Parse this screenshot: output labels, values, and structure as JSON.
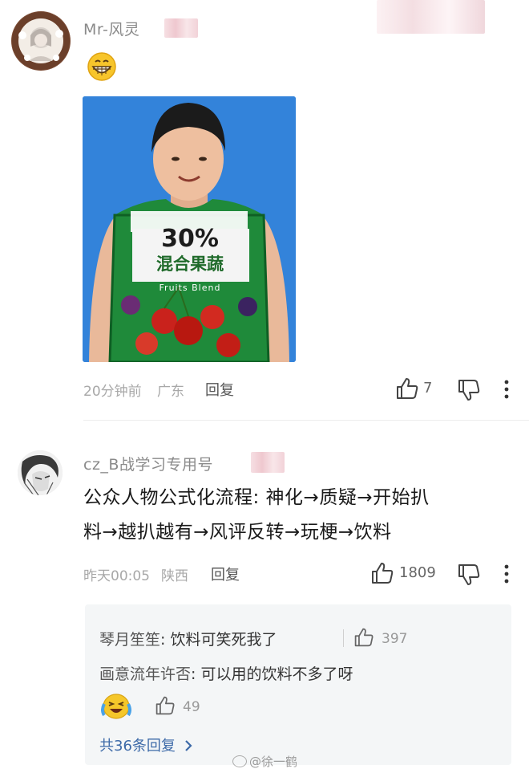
{
  "comments": [
    {
      "username": "Mr-风灵",
      "emoji": "grinning-face",
      "time": "20分钟前",
      "location": "广东",
      "reply_label": "回复",
      "likes": "7",
      "shirt": {
        "line1": "30%",
        "line2": "混合果蔬",
        "line3": "Fruits Blend"
      }
    },
    {
      "username": "cz_B战学习专用号",
      "text_line1": "公众人物公式化流程: 神化→质疑→开始扒",
      "text_line2": "料→越扒越有→风评反转→玩梗→饮料",
      "time": "昨天00:05",
      "location": "陕西",
      "reply_label": "回复",
      "likes": "1809",
      "replies": [
        {
          "author": "琴月笙笙",
          "text": "饮料可笑死我了",
          "likes": "397"
        },
        {
          "author": "画意流年许否",
          "text": "可以用的饮料不多了呀",
          "likes": "49",
          "emoji": "crying-laughing-face"
        }
      ],
      "more_replies": "共36条回复"
    }
  ],
  "watermark": "@徐一鹤",
  "colors": {
    "link": "#3d6aa8",
    "photo_bg": "#2f7fd6",
    "panel": "#f4f6f7"
  }
}
